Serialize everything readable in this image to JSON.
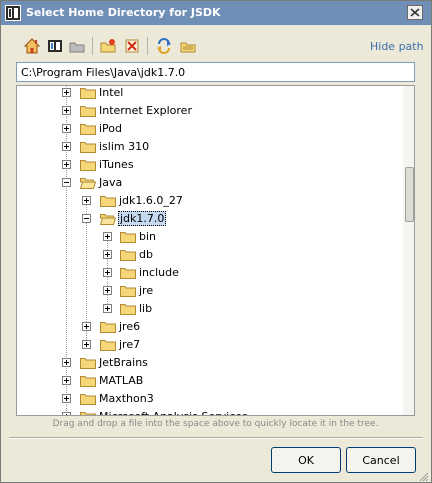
{
  "window": {
    "title": "Select Home Directory for JSDK",
    "icon": "intellij-app-icon",
    "close_icon": "close-icon"
  },
  "toolbar": {
    "buttons": [
      {
        "icon": "home-icon",
        "name": "home-button"
      },
      {
        "icon": "project-icon",
        "name": "project-button"
      },
      {
        "icon": "module-icon",
        "name": "module-button"
      },
      {
        "icon": "new-folder-icon",
        "name": "new-folder-button"
      },
      {
        "icon": "delete-icon",
        "name": "delete-button"
      },
      {
        "icon": "refresh-icon",
        "name": "refresh-button"
      },
      {
        "icon": "show-hidden-icon",
        "name": "show-hidden-button"
      }
    ],
    "hide_path_label": "Hide path"
  },
  "path": {
    "value": "C:\\Program Files\\Java\\jdk1.7.0"
  },
  "tree": {
    "items": [
      {
        "label": "Intel",
        "level": 0,
        "expanded": false
      },
      {
        "label": "Internet Explorer",
        "level": 0,
        "expanded": false
      },
      {
        "label": "iPod",
        "level": 0,
        "expanded": false
      },
      {
        "label": "islim 310",
        "level": 0,
        "expanded": false
      },
      {
        "label": "iTunes",
        "level": 0,
        "expanded": false
      },
      {
        "label": "Java",
        "level": 0,
        "expanded": true
      },
      {
        "label": "jdk1.6.0_27",
        "level": 1,
        "expanded": false
      },
      {
        "label": "jdk1.7.0",
        "level": 1,
        "expanded": true,
        "selected": true
      },
      {
        "label": "bin",
        "level": 2,
        "expanded": false
      },
      {
        "label": "db",
        "level": 2,
        "expanded": false
      },
      {
        "label": "include",
        "level": 2,
        "expanded": false
      },
      {
        "label": "jre",
        "level": 2,
        "expanded": false
      },
      {
        "label": "lib",
        "level": 2,
        "expanded": false
      },
      {
        "label": "jre6",
        "level": 1,
        "expanded": false
      },
      {
        "label": "jre7",
        "level": 1,
        "expanded": false
      },
      {
        "label": "JetBrains",
        "level": 0,
        "expanded": false
      },
      {
        "label": "MATLAB",
        "level": 0,
        "expanded": false
      },
      {
        "label": "Maxthon3",
        "level": 0,
        "expanded": false
      },
      {
        "label": "Microsoft Analysis Services",
        "level": 0,
        "expanded": false
      }
    ]
  },
  "hint": "Drag and drop a file into the space above to quickly locate it in the tree.",
  "buttons": {
    "ok": "OK",
    "cancel": "Cancel"
  },
  "colors": {
    "title_bar": "#6f8fb6",
    "link": "#3a6fb0",
    "selection": "#c5d9f1",
    "folder": "#f5d77a"
  }
}
